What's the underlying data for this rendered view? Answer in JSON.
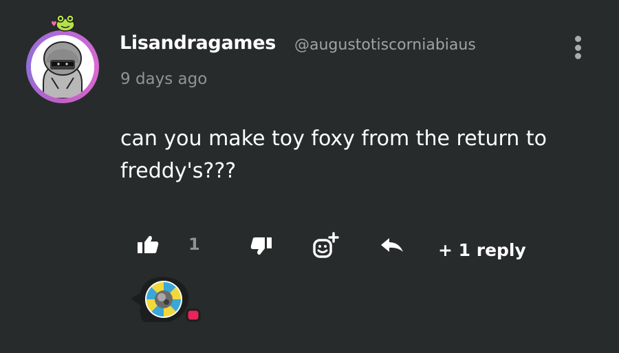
{
  "comment": {
    "author_name": "Lisandragames",
    "author_handle": "@augustotiscorniabiaus",
    "timestamp": "9 days ago",
    "text": "can you make toy foxy from the return to freddy's???"
  },
  "actions": {
    "like_icon": "thumbs-up-icon",
    "like_count": "1",
    "dislike_icon": "thumbs-down-icon",
    "emoji_icon": "add-reaction-icon",
    "reply_icon": "reply-arrow-icon",
    "replies_label": "+ 1 reply"
  },
  "colors": {
    "background": "#282b2b",
    "secondary_text": "#8f9595",
    "avatar_ring": "#c45fc8",
    "notification_dot": "#e8245a"
  }
}
